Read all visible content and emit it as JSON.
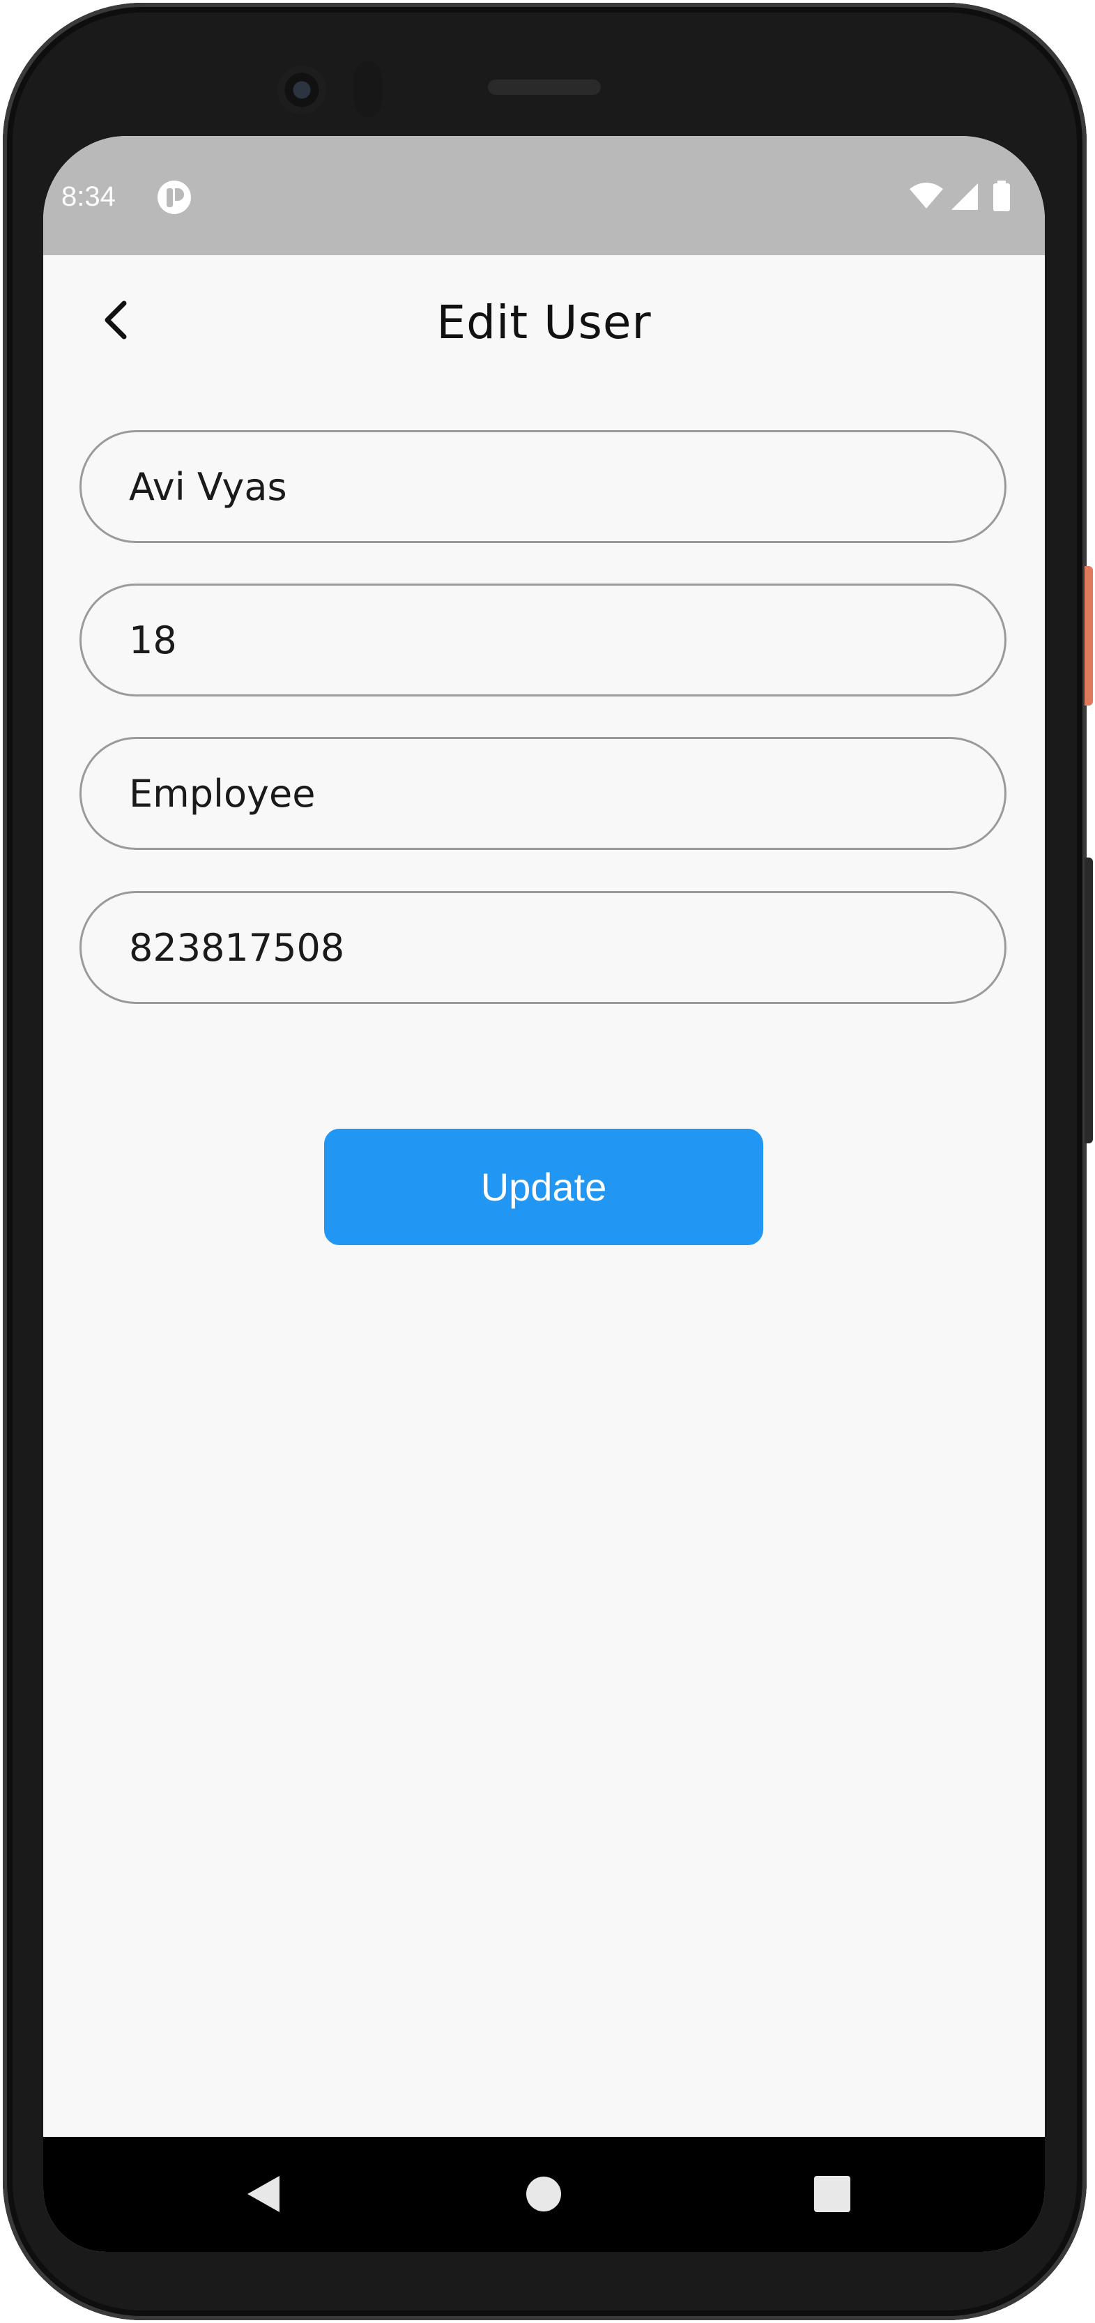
{
  "status_bar": {
    "time": "8:34",
    "app_icon": "pocket-p-icon",
    "wifi_icon": "wifi-icon",
    "signal_icon": "cell-signal-icon",
    "battery_icon": "battery-icon"
  },
  "header": {
    "title": "Edit User",
    "back_icon": "chevron-left-icon"
  },
  "form": {
    "name_value": "Avi Vyas",
    "age_value": "18",
    "role_value": "Employee",
    "phone_value": "823817508"
  },
  "actions": {
    "update_label": "Update"
  },
  "nav_bar": {
    "back_icon": "triangle-back-icon",
    "home_icon": "circle-home-icon",
    "recent_icon": "square-recents-icon"
  },
  "colors": {
    "accent": "#2196f3",
    "status_bar": "#b9b9b9",
    "background": "#f8f8f8",
    "field_border": "#9a9a9a"
  }
}
